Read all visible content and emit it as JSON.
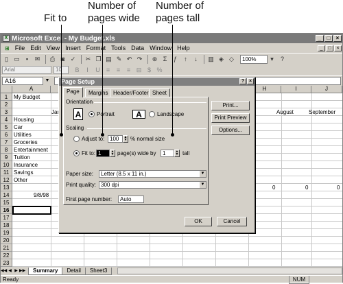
{
  "callouts": {
    "fit_to": "Fit to",
    "pages_wide": "Number of\npages wide",
    "pages_tall": "Number of\npages tall"
  },
  "window": {
    "title": "Microsoft Excel - My Budget.xls",
    "min": "_",
    "max": "□",
    "close": "×"
  },
  "menu": [
    "File",
    "Edit",
    "View",
    "Insert",
    "Format",
    "Tools",
    "Data",
    "Window",
    "Help"
  ],
  "toolbar": {
    "zoom": "100%",
    "font": "Arial",
    "size": "10"
  },
  "formula_bar": {
    "name_box": "A16"
  },
  "columns": [
    "A",
    "B",
    "C",
    "D",
    "E",
    "F",
    "G",
    "H",
    "I",
    "J"
  ],
  "rows": [
    "1",
    "2",
    "3",
    "4",
    "5",
    "6",
    "7",
    "8",
    "9",
    "10",
    "11",
    "12",
    "13",
    "14",
    "15",
    "16",
    "17",
    "18",
    "19",
    "20",
    "21",
    "22",
    "23",
    "24"
  ],
  "cells": {
    "a1": "My Budget",
    "b3": "Jan",
    "h3": "",
    "i3": "August",
    "j3": "September",
    "a4": "Housing",
    "a5": "Car",
    "a6": "Utilities",
    "a7": "Groceries",
    "a8": "Entertainment",
    "a9": "Tuition",
    "a10": "Insurance",
    "a11": "Savings",
    "a12": "Other",
    "a14": "9/8/98",
    "h14": "0",
    "i14": "0",
    "j14": "0"
  },
  "sheet_tabs": [
    "Summary",
    "Detail",
    "Sheet3"
  ],
  "status": {
    "left": "Ready",
    "num": "NUM"
  },
  "dialog": {
    "title": "Page Setup",
    "help": "?",
    "close": "×",
    "tabs": [
      "Page",
      "Margins",
      "Header/Footer",
      "Sheet"
    ],
    "orientation_label": "Orientation",
    "portrait": "Portrait",
    "landscape": "Landscape",
    "scaling_label": "Scaling",
    "adjust_to": "Adjust to:",
    "adjust_value": "100",
    "normal_size": "% normal size",
    "fit_to": "Fit to:",
    "pages_wide_value": "1",
    "wide_by": "page(s) wide by",
    "pages_tall_value": "1",
    "tall": "tall",
    "paper_size_label": "Paper size:",
    "paper_size": "Letter (8.5 x 11 in.)",
    "print_quality_label": "Print quality:",
    "print_quality": "300 dpi",
    "first_page_label": "First page number:",
    "first_page": "Auto",
    "print_btn": "Print...",
    "preview_btn": "Print Preview",
    "options_btn": "Options...",
    "ok_btn": "OK",
    "cancel_btn": "Cancel"
  }
}
